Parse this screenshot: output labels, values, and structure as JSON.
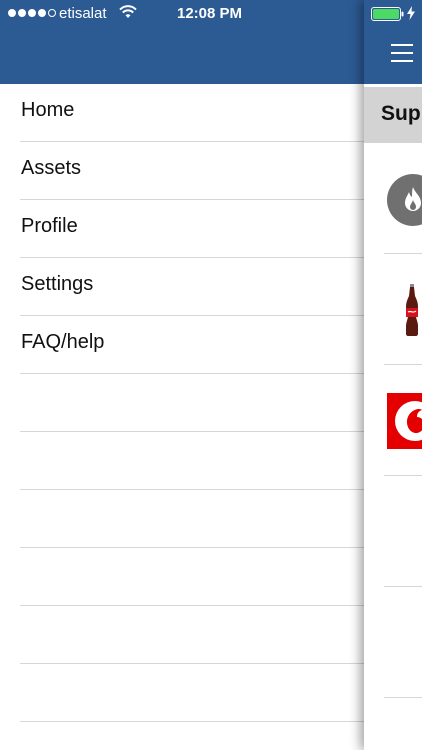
{
  "status_bar": {
    "signal_dots": 5,
    "carrier": "etisalat",
    "time": "12:08 PM",
    "battery_level": 1.0,
    "charging": true
  },
  "colors": {
    "header_blue": "#2c5a93",
    "section_header_gray": "#d3d3d3",
    "separator": "#d6d6d6"
  },
  "drawer": {
    "menu_items": [
      {
        "label": "Home"
      },
      {
        "label": "Assets"
      },
      {
        "label": "Profile"
      },
      {
        "label": "Settings"
      },
      {
        "label": "FAQ/help"
      }
    ],
    "empty_rows": 7
  },
  "content": {
    "section_title": "Sup",
    "suppliers": [
      {
        "logo": "gas-flame-icon"
      },
      {
        "logo": "coca-cola-bottle-icon"
      },
      {
        "logo": "vodafone-logo-icon"
      },
      {
        "logo": ""
      },
      {
        "logo": ""
      }
    ]
  }
}
